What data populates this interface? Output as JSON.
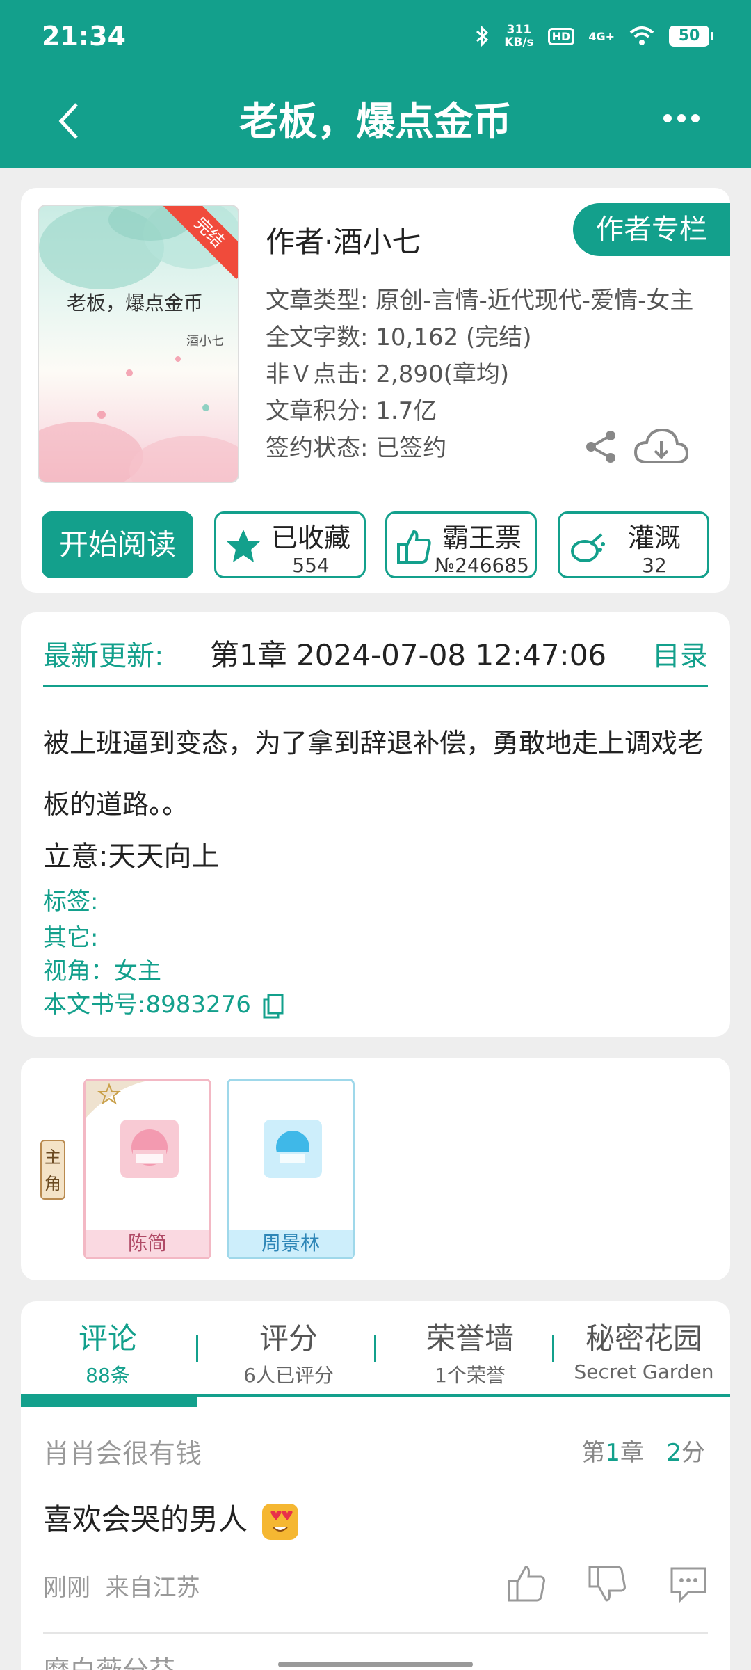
{
  "status": {
    "time": "21:34",
    "speed_top": "311",
    "speed_bottom": "KB/s",
    "hd": "HD",
    "net": "4G+",
    "battery": "50"
  },
  "nav": {
    "title": "老板，爆点金币"
  },
  "book": {
    "cover_title": "老板，爆点金币",
    "cover_author": "酒小七",
    "cover_badge": "完结",
    "author": "作者·酒小七",
    "author_column": "作者专栏",
    "meta": [
      "文章类型: 原创-言情-近代现代-爱情-女主",
      "全文字数: 10,162 (完结)",
      "非Ｖ点击: 2,890(章均)",
      "文章积分: 1.7亿",
      "签约状态: 已签约"
    ],
    "read_btn": "开始阅读",
    "actions": [
      {
        "label": "已收藏",
        "num": "554"
      },
      {
        "label": "霸王票",
        "num": "№246685"
      },
      {
        "label": "灌溉",
        "num": "32"
      }
    ]
  },
  "update": {
    "label": "最新更新:",
    "text": "第1章  2024-07-08 12:47:06",
    "catalog": "目录",
    "summary": "被上班逼到变态，为了拿到辞退补偿，勇敢地走上调戏老板的道路。。",
    "idea": "立意:天天向上",
    "tags": "标签:",
    "other": "其它:",
    "view": "视角：女主",
    "book_no": "本文书号:8983276"
  },
  "characters": {
    "role": "主角",
    "list": [
      {
        "name": "陈简"
      },
      {
        "name": "周景林"
      }
    ]
  },
  "tabs": [
    {
      "title": "评论",
      "sub": "88条"
    },
    {
      "title": "评分",
      "sub": "6人已评分"
    },
    {
      "title": "荣誉墙",
      "sub": "1个荣誉"
    },
    {
      "title": "秘密花园",
      "sub": "Secret Garden"
    }
  ],
  "comment": {
    "user": "肖肖会很有钱",
    "chapter_pre": "第",
    "chapter_num": "1",
    "chapter_post": "章",
    "score_num": "2",
    "score_unit": "分",
    "text": "喜欢会哭的男人",
    "time": "刚刚",
    "location": "来自江苏",
    "next_user": "摩白薇分芬"
  },
  "colors": {
    "accent": "#13a08c"
  }
}
